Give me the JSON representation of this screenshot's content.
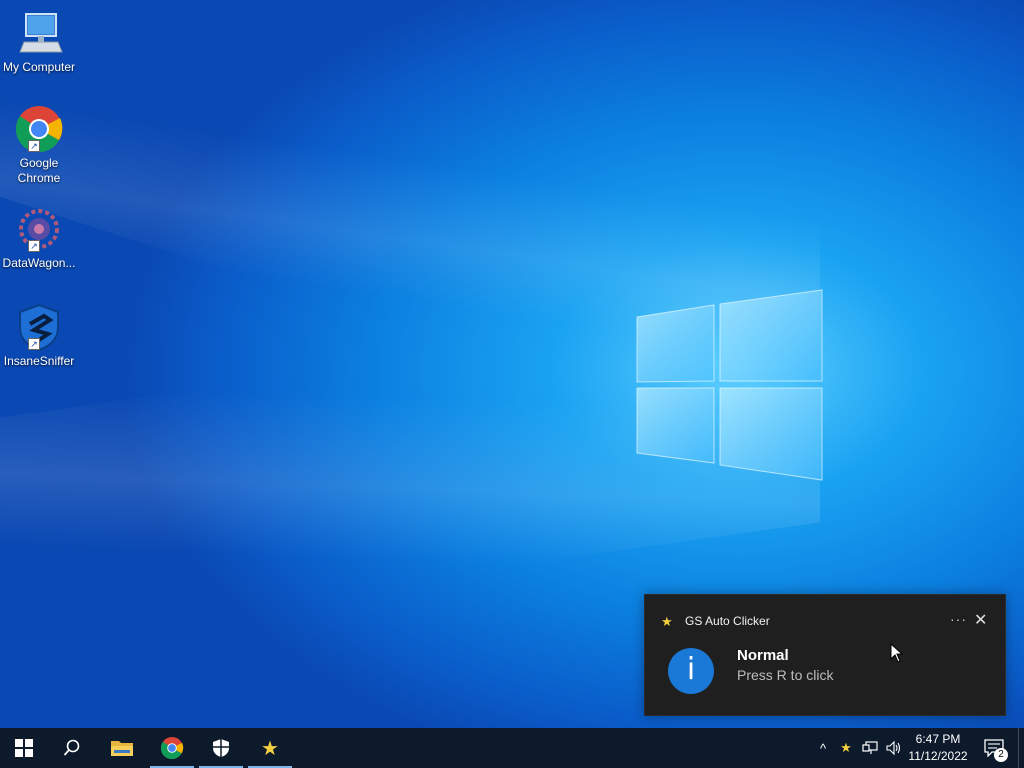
{
  "desktop": {
    "icons": [
      {
        "label": "My Computer",
        "icon": "computer-icon"
      },
      {
        "label": "Google Chrome",
        "icon": "chrome-icon"
      },
      {
        "label": "DataWagon...",
        "icon": "datawagon-icon"
      },
      {
        "label": "InsaneSniffer",
        "icon": "insanesniffer-icon"
      }
    ],
    "wallpaper_accent": "#1aa3f2"
  },
  "toast": {
    "app_name": "GS Auto Clicker",
    "app_icon": "star-icon",
    "more_label": "···",
    "close_label": "✕",
    "info_glyph": "i",
    "title": "Normal",
    "body": "Press R to click",
    "background": "#1f1f1f"
  },
  "taskbar": {
    "pinned": [
      {
        "name": "start-button",
        "icon": "windows-icon"
      },
      {
        "name": "search-button",
        "icon": "search-icon"
      },
      {
        "name": "file-explorer",
        "icon": "folder-icon"
      },
      {
        "name": "chrome",
        "icon": "chrome-icon"
      },
      {
        "name": "security",
        "icon": "shield-icon"
      },
      {
        "name": "gs-auto-clicker",
        "icon": "star-icon"
      }
    ],
    "tray": {
      "chevron": "^",
      "clock_time": "6:47 PM",
      "clock_date": "11/12/2022",
      "notification_count": "2"
    },
    "background": "#0c1a2c"
  }
}
